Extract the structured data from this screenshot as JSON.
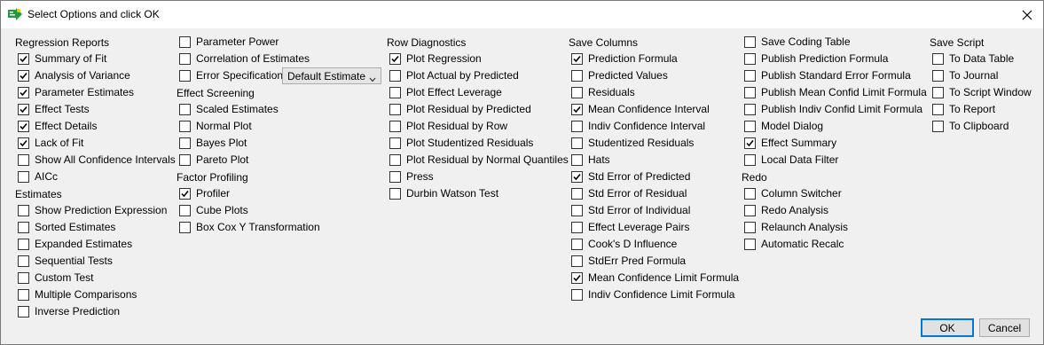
{
  "window": {
    "title": "Select Options and click OK"
  },
  "columns": [
    {
      "items": [
        {
          "type": "header",
          "label": "Regression Reports"
        },
        {
          "type": "checkbox",
          "label": "Summary of Fit",
          "checked": true
        },
        {
          "type": "checkbox",
          "label": "Analysis of Variance",
          "checked": true
        },
        {
          "type": "checkbox",
          "label": "Parameter Estimates",
          "checked": true
        },
        {
          "type": "checkbox",
          "label": "Effect Tests",
          "checked": true
        },
        {
          "type": "checkbox",
          "label": "Effect Details",
          "checked": true
        },
        {
          "type": "checkbox",
          "label": "Lack of Fit",
          "checked": true
        },
        {
          "type": "checkbox",
          "label": "Show All Confidence Intervals",
          "checked": false
        },
        {
          "type": "checkbox",
          "label": "AICc",
          "checked": false
        },
        {
          "type": "header",
          "label": "Estimates"
        },
        {
          "type": "checkbox",
          "label": "Show Prediction Expression",
          "checked": false
        },
        {
          "type": "checkbox",
          "label": "Sorted Estimates",
          "checked": false
        },
        {
          "type": "checkbox",
          "label": "Expanded  Estimates",
          "checked": false
        },
        {
          "type": "checkbox",
          "label": "Sequential Tests",
          "checked": false
        },
        {
          "type": "checkbox",
          "label": "Custom Test",
          "checked": false
        },
        {
          "type": "checkbox",
          "label": "Multiple Comparisons",
          "checked": false
        },
        {
          "type": "checkbox",
          "label": "Inverse Prediction",
          "checked": false
        }
      ]
    },
    {
      "items": [
        {
          "type": "checkbox",
          "label": "Parameter Power",
          "checked": false
        },
        {
          "type": "checkbox",
          "label": "Correlation of Estimates",
          "checked": false
        },
        {
          "type": "checkbox",
          "label": "Error Specification",
          "checked": false,
          "select": "Default Estimate"
        },
        {
          "type": "header",
          "label": "Effect Screening"
        },
        {
          "type": "checkbox",
          "label": "Scaled Estimates",
          "checked": false
        },
        {
          "type": "checkbox",
          "label": "Normal Plot",
          "checked": false
        },
        {
          "type": "checkbox",
          "label": "Bayes Plot",
          "checked": false
        },
        {
          "type": "checkbox",
          "label": "Pareto Plot",
          "checked": false
        },
        {
          "type": "header",
          "label": "Factor Profiling"
        },
        {
          "type": "checkbox",
          "label": "Profiler",
          "checked": true
        },
        {
          "type": "checkbox",
          "label": "Cube Plots",
          "checked": false
        },
        {
          "type": "checkbox",
          "label": "Box Cox Y Transformation",
          "checked": false
        }
      ]
    },
    {
      "items": [
        {
          "type": "header",
          "label": "Row Diagnostics"
        },
        {
          "type": "checkbox",
          "label": "Plot Regression",
          "checked": true
        },
        {
          "type": "checkbox",
          "label": "Plot Actual by Predicted",
          "checked": false
        },
        {
          "type": "checkbox",
          "label": "Plot Effect Leverage",
          "checked": false
        },
        {
          "type": "checkbox",
          "label": "Plot Residual by Predicted",
          "checked": false
        },
        {
          "type": "checkbox",
          "label": "Plot Residual by Row",
          "checked": false
        },
        {
          "type": "checkbox",
          "label": "Plot Studentized Residuals",
          "checked": false
        },
        {
          "type": "checkbox",
          "label": "Plot Residual by Normal Quantiles",
          "checked": false
        },
        {
          "type": "checkbox",
          "label": "Press",
          "checked": false
        },
        {
          "type": "checkbox",
          "label": "Durbin Watson Test",
          "checked": false
        }
      ]
    },
    {
      "items": [
        {
          "type": "header",
          "label": "Save Columns"
        },
        {
          "type": "checkbox",
          "label": "Prediction Formula",
          "checked": true
        },
        {
          "type": "checkbox",
          "label": "Predicted Values",
          "checked": false
        },
        {
          "type": "checkbox",
          "label": "Residuals",
          "checked": false
        },
        {
          "type": "checkbox",
          "label": "Mean Confidence Interval",
          "checked": true
        },
        {
          "type": "checkbox",
          "label": "Indiv Confidence Interval",
          "checked": false
        },
        {
          "type": "checkbox",
          "label": "Studentized Residuals",
          "checked": false
        },
        {
          "type": "checkbox",
          "label": "Hats",
          "checked": false
        },
        {
          "type": "checkbox",
          "label": "Std Error of Predicted",
          "checked": true
        },
        {
          "type": "checkbox",
          "label": "Std Error of Residual",
          "checked": false
        },
        {
          "type": "checkbox",
          "label": "Std Error of Individual",
          "checked": false
        },
        {
          "type": "checkbox",
          "label": "Effect Leverage Pairs",
          "checked": false
        },
        {
          "type": "checkbox",
          "label": "Cook's D Influence",
          "checked": false
        },
        {
          "type": "checkbox",
          "label": "StdErr Pred Formula",
          "checked": false
        },
        {
          "type": "checkbox",
          "label": "Mean Confidence Limit Formula",
          "checked": true
        },
        {
          "type": "checkbox",
          "label": "Indiv Confidence Limit Formula",
          "checked": false
        }
      ]
    },
    {
      "items": [
        {
          "type": "checkbox",
          "label": "Save Coding Table",
          "checked": false
        },
        {
          "type": "checkbox",
          "label": "Publish Prediction Formula",
          "checked": false
        },
        {
          "type": "checkbox",
          "label": "Publish Standard Error Formula",
          "checked": false
        },
        {
          "type": "checkbox",
          "label": "Publish Mean Confid Limit Formula",
          "checked": false
        },
        {
          "type": "checkbox",
          "label": "Publish Indiv Confid Limit Formula",
          "checked": false
        },
        {
          "type": "checkbox",
          "label": "Model Dialog",
          "checked": false
        },
        {
          "type": "checkbox",
          "label": "Effect Summary",
          "checked": true
        },
        {
          "type": "checkbox",
          "label": "Local Data Filter",
          "checked": false
        },
        {
          "type": "header",
          "label": "Redo"
        },
        {
          "type": "checkbox",
          "label": "Column Switcher",
          "checked": false
        },
        {
          "type": "checkbox",
          "label": "Redo Analysis",
          "checked": false
        },
        {
          "type": "checkbox",
          "label": "Relaunch Analysis",
          "checked": false
        },
        {
          "type": "checkbox",
          "label": "Automatic Recalc",
          "checked": false
        }
      ]
    },
    {
      "items": [
        {
          "type": "header",
          "label": "Save Script"
        },
        {
          "type": "checkbox",
          "label": "To Data Table",
          "checked": false
        },
        {
          "type": "checkbox",
          "label": "To Journal",
          "checked": false
        },
        {
          "type": "checkbox",
          "label": "To Script Window",
          "checked": false
        },
        {
          "type": "checkbox",
          "label": "To Report",
          "checked": false
        },
        {
          "type": "checkbox",
          "label": "To Clipboard",
          "checked": false
        }
      ]
    }
  ],
  "buttons": {
    "ok": "OK",
    "cancel": "Cancel"
  },
  "icons": {
    "app": "jmp-app-icon",
    "close": "close-icon"
  }
}
